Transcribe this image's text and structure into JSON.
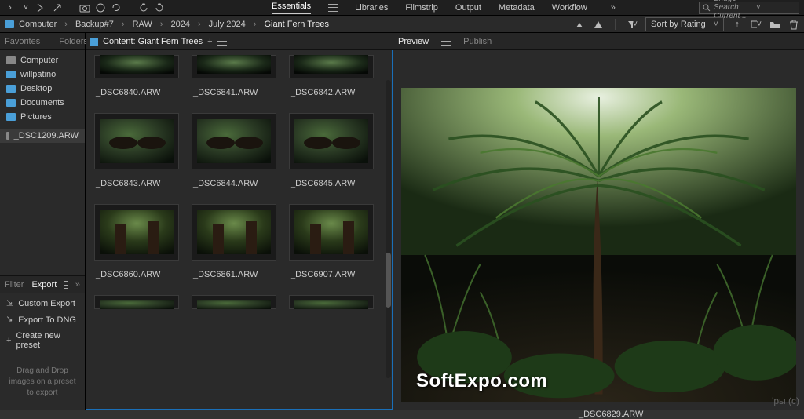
{
  "titlebar": {
    "tabs": [
      "Essentials",
      "Libraries",
      "Filmstrip",
      "Output",
      "Metadata",
      "Workflow"
    ],
    "search_placeholder": "Bridge Search: Current .."
  },
  "breadcrumb": {
    "items": [
      "Computer",
      "Backup#7",
      "RAW",
      "2024",
      "July 2024",
      "Giant Fern Trees"
    ],
    "sort_label": "Sort by Rating"
  },
  "leftpanel": {
    "tabs": [
      "Favorites",
      "Folders"
    ],
    "folders": [
      {
        "label": "Computer",
        "color": "gray"
      },
      {
        "label": "willpatino",
        "color": "blue"
      },
      {
        "label": "Desktop",
        "color": "blue"
      },
      {
        "label": "Documents",
        "color": "blue"
      },
      {
        "label": "Pictures",
        "color": "blue"
      }
    ],
    "file_item": "_DSC1209.ARW",
    "filter_tab": "Filter",
    "export_tab": "Export",
    "export_items": [
      "Custom Export",
      "Export To DNG",
      "Create new preset"
    ],
    "drag_hint": "Drag and Drop images on a preset to export"
  },
  "content": {
    "header": "Content: Giant Fern Trees",
    "thumbs": [
      [
        "_DSC6840.ARW",
        "_DSC6841.ARW",
        "_DSC6842.ARW"
      ],
      [
        "_DSC6843.ARW",
        "_DSC6844.ARW",
        "_DSC6845.ARW"
      ],
      [
        "_DSC6860.ARW",
        "_DSC6861.ARW",
        "_DSC6907.ARW"
      ]
    ]
  },
  "preview": {
    "tabs": [
      "Preview",
      "Publish"
    ],
    "filename": "_DSC6829.ARW"
  },
  "watermark": "SoftExpo.com",
  "copyright": "'pы (c)"
}
